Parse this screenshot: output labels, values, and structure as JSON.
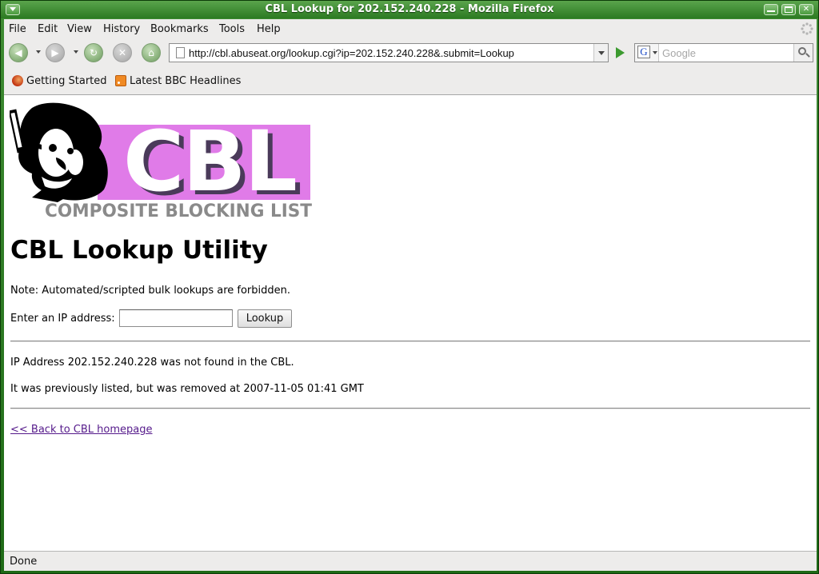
{
  "window": {
    "title": "CBL Lookup for 202.152.240.228 - Mozilla Firefox"
  },
  "menubar": {
    "items": [
      {
        "label": "File"
      },
      {
        "label": "Edit"
      },
      {
        "label": "View"
      },
      {
        "label": "History"
      },
      {
        "label": "Bookmarks"
      },
      {
        "label": "Tools"
      },
      {
        "label": "Help"
      }
    ]
  },
  "toolbar": {
    "url": "http://cbl.abuseat.org/lookup.cgi?ip=202.152.240.228&.submit=Lookup",
    "search_engine": "G",
    "search_placeholder": "Google"
  },
  "bookmarks": {
    "items": [
      {
        "label": "Getting Started",
        "icon": "firefox-icon"
      },
      {
        "label": "Latest BBC Headlines",
        "icon": "rss-feed-icon"
      }
    ]
  },
  "page": {
    "logo": {
      "letters": "CBL",
      "tagline": "COMPOSITE BLOCKING LIST",
      "accent": "#e07be8"
    },
    "heading": "CBL Lookup Utility",
    "note": "Note: Automated/scripted bulk lookups are forbidden.",
    "ip_label": "Enter an IP address:",
    "ip_value": "",
    "lookup_label": "Lookup",
    "result_line_1": "IP Address 202.152.240.228 was not found in the CBL.",
    "result_line_2": "It was previously listed, but was removed at 2007-11-05 01:41 GMT",
    "back_link": "<< Back to CBL homepage"
  },
  "status": {
    "text": "Done"
  },
  "colors": {
    "frame": "#2c7a22",
    "link_visited": "#551a8b",
    "chrome": "#edeceb"
  }
}
